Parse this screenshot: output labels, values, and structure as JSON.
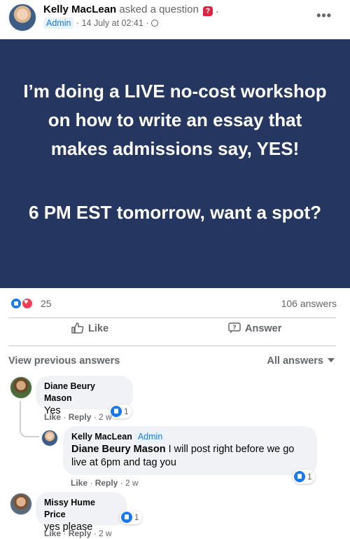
{
  "post": {
    "author": "Kelly MacLean",
    "action_text": "asked a question",
    "question_icon": "?",
    "trailing_dot": ".",
    "badge": "Admin",
    "separator": "·",
    "timestamp": "14 July at 02:41",
    "separator2": "·",
    "more_icon": "•••"
  },
  "banner": {
    "line1": "I’m doing a LIVE no-cost workshop on how to write an essay that makes admissions say, YES!",
    "line2": "6 PM EST tomorrow, want a spot?",
    "background_color": "#253760"
  },
  "stats": {
    "reaction_count": "25",
    "answers_count": "106 answers"
  },
  "actions": {
    "like_label": "Like",
    "answer_label": "Answer"
  },
  "answers_header": {
    "view_previous": "View previous answers",
    "filter_label": "All answers"
  },
  "comments": [
    {
      "name": "Diane Beury Mason",
      "text": "Yes",
      "likes": "1",
      "like_action": "Like",
      "reply_action": "Reply",
      "time": "2 w"
    },
    {
      "name": "Kelly MacLean",
      "badge": "Admin",
      "tag": "Diane Beury Mason",
      "text": " I will post right before we go live at 6pm and tag you",
      "likes": "1",
      "like_action": "Like",
      "reply_action": "Reply",
      "time": "2 w"
    },
    {
      "name": "Missy Hume Price",
      "text": "yes please",
      "likes": "1",
      "like_action": "Like",
      "reply_action": "Reply",
      "time": "2 w"
    }
  ],
  "colors": {
    "accent": "#1877f2",
    "love": "#f33e58",
    "secondary_text": "#65676b"
  }
}
